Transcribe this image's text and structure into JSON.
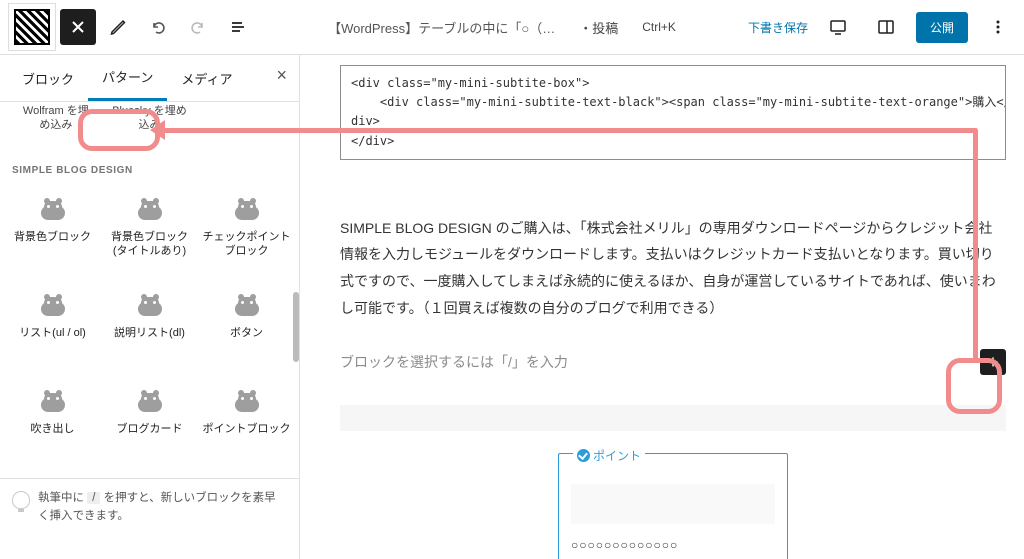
{
  "topbar": {
    "doc_title": "【WordPress】テーブルの中に「○（…",
    "doc_type": "・投稿",
    "shortcut": "Ctrl+K",
    "save_draft": "下書き保存",
    "publish": "公開"
  },
  "sidebar": {
    "tabs": {
      "blocks": "ブロック",
      "patterns": "パターン",
      "media": "メディア"
    },
    "embed_items": [
      {
        "label": "Wolfram を埋\nめ込み"
      },
      {
        "label": "Bluesky を埋め\n込み"
      }
    ],
    "section_title": "SIMPLE BLOG DESIGN",
    "blocks": [
      {
        "label": "背景色ブロック"
      },
      {
        "label": "背景色ブロック(タイトルあり)"
      },
      {
        "label": "チェックポイントブロック"
      },
      {
        "label": "リスト(ul / ol)"
      },
      {
        "label": "説明リスト(dl)"
      },
      {
        "label": "ボタン"
      },
      {
        "label": "吹き出し"
      },
      {
        "label": "ブログカード"
      },
      {
        "label": "ポイントブロック"
      }
    ],
    "tip_pre": "執筆中に ",
    "tip_key": "/",
    "tip_post": " を押すと、新しいブロックを素早く挿入できます。"
  },
  "editor": {
    "code_line1": "<div class=\"my-mini-subtite-box\">",
    "code_line2": "    <div class=\"my-mini-subtite-text-black\"><span class=\"my-mini-subtite-text-orange\">購入</span></",
    "code_line3": "div>",
    "paragraph": "SIMPLE BLOG DESIGN のご購入は、「株式会社メリル」の専用ダウンロードページからクレジット会社情報を入力しモジュールをダウンロードします。支払いはクレジットカード支払いとなります。買い切り式ですので、一度購入してしまえば永続的に使えるほか、自身が運営しているサイトであれば、使いまわし可能です。（１回買えば複数の自分のブログで利用できる）",
    "placeholder": "ブロックを選択するには「/」を入力",
    "point_label": "ポイント",
    "point_body": "○○○○○○○○○○○○○"
  }
}
